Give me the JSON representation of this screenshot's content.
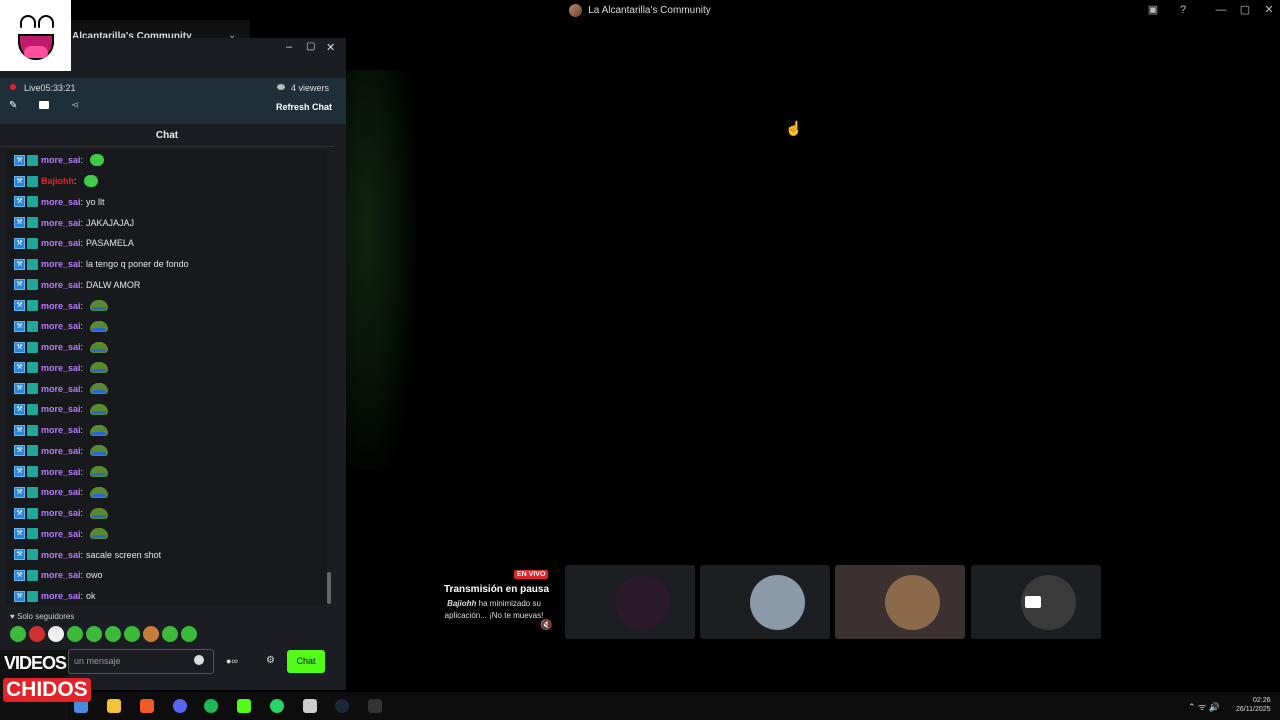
{
  "window": {
    "title": "La Alcantarilla's Community",
    "controls": [
      "—",
      "▢",
      "✕"
    ]
  },
  "server": {
    "name": "Alcantarilla's Community"
  },
  "popout": {
    "live_label": "Live",
    "live_time": "05:33:21",
    "viewers": "4 viewers",
    "refresh": "Refresh Chat",
    "chat_title": "Chat",
    "followers_only": "Solo seguidores",
    "input_placeholder": "un mensaje",
    "send_label": "Chat"
  },
  "chat": [
    {
      "user": "more_sai",
      "text": "",
      "emote": "green"
    },
    {
      "user": "Bajiohh",
      "text": "",
      "emote": "green",
      "red": true
    },
    {
      "user": "more_sai",
      "text": "yo llt"
    },
    {
      "user": "more_sai",
      "text": "JAKAJAJAJ"
    },
    {
      "user": "more_sai",
      "text": "PASAMELA"
    },
    {
      "user": "more_sai",
      "text": "la tengo q poner de fondo"
    },
    {
      "user": "more_sai",
      "text": "DALW AMOR"
    },
    {
      "user": "more_sai",
      "text": "",
      "emote": "pepe"
    },
    {
      "user": "more_sai",
      "text": "",
      "emote": "pepe"
    },
    {
      "user": "more_sai",
      "text": "",
      "emote": "pepe"
    },
    {
      "user": "more_sai",
      "text": "",
      "emote": "pepe"
    },
    {
      "user": "more_sai",
      "text": "",
      "emote": "pepe"
    },
    {
      "user": "more_sai",
      "text": "",
      "emote": "pepe"
    },
    {
      "user": "more_sai",
      "text": "",
      "emote": "pepe"
    },
    {
      "user": "more_sai",
      "text": "",
      "emote": "pepe"
    },
    {
      "user": "more_sai",
      "text": "",
      "emote": "pepe"
    },
    {
      "user": "more_sai",
      "text": "",
      "emote": "pepe"
    },
    {
      "user": "more_sai",
      "text": "",
      "emote": "pepe"
    },
    {
      "user": "more_sai",
      "text": "",
      "emote": "pepe"
    },
    {
      "user": "more_sai",
      "text": "sacale screen shot"
    },
    {
      "user": "more_sai",
      "text": "owo"
    },
    {
      "user": "more_sai",
      "text": "ok"
    }
  ],
  "stream": {
    "badge": "EN VIVO",
    "pause_title": "Transmisión en pausa",
    "pause_user": "Bajiohh",
    "pause_text": "ha minimizado su aplicación... ¡No te muevas!"
  },
  "taskbar": {
    "time": "02:26",
    "date": "26/11/2025"
  },
  "logo": {
    "line1": "VIDEOS",
    "line2": "CHIDOS"
  },
  "colors": {
    "accent": "#53fc18",
    "live_red": "#e2232a",
    "username": "#b57aff"
  }
}
